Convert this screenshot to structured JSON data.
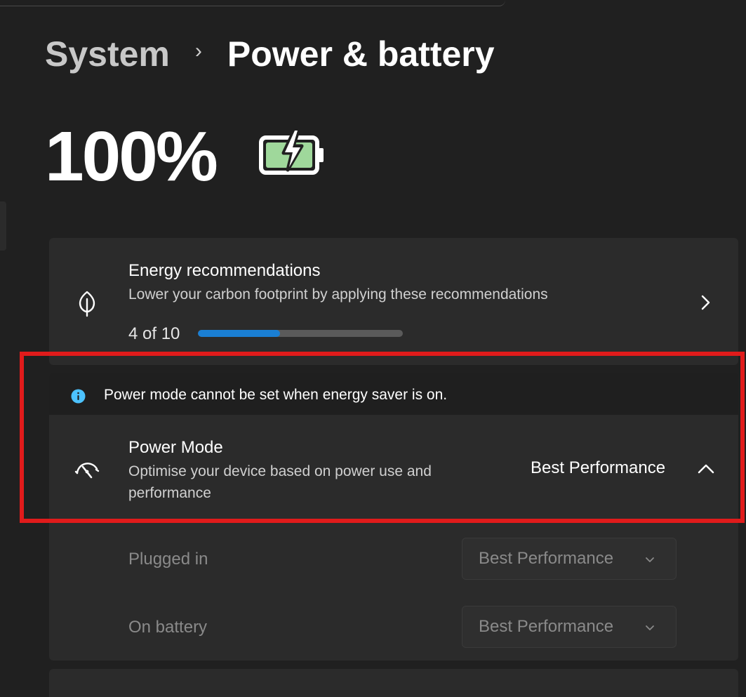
{
  "breadcrumb": {
    "parent": "System",
    "separator": "›",
    "current": "Power & battery"
  },
  "battery": {
    "percent": "100%",
    "level": 1.0,
    "charging": true,
    "fill_color": "#9fd89b"
  },
  "energy_recommendations": {
    "title": "Energy recommendations",
    "subtitle": "Lower your carbon footprint by applying these recommendations",
    "progress_label": "4 of 10",
    "progress_fraction": 0.4,
    "icon": "leaf-icon"
  },
  "info_bar": {
    "message": "Power mode cannot be set when energy saver is on.",
    "icon": "info-icon",
    "icon_color": "#4cc2ff"
  },
  "power_mode": {
    "title": "Power Mode",
    "subtitle_line1": "Optimise your device based on power use and",
    "subtitle_line2": "performance",
    "value": "Best Performance",
    "icon": "speedometer-icon",
    "expanded": true,
    "plugged_in": {
      "label": "Plugged in",
      "value": "Best Performance",
      "disabled": true
    },
    "on_battery": {
      "label": "On battery",
      "value": "Best Performance",
      "disabled": true
    }
  },
  "colors": {
    "accent": "#1a7fd4",
    "highlight": "#e01b1b"
  }
}
